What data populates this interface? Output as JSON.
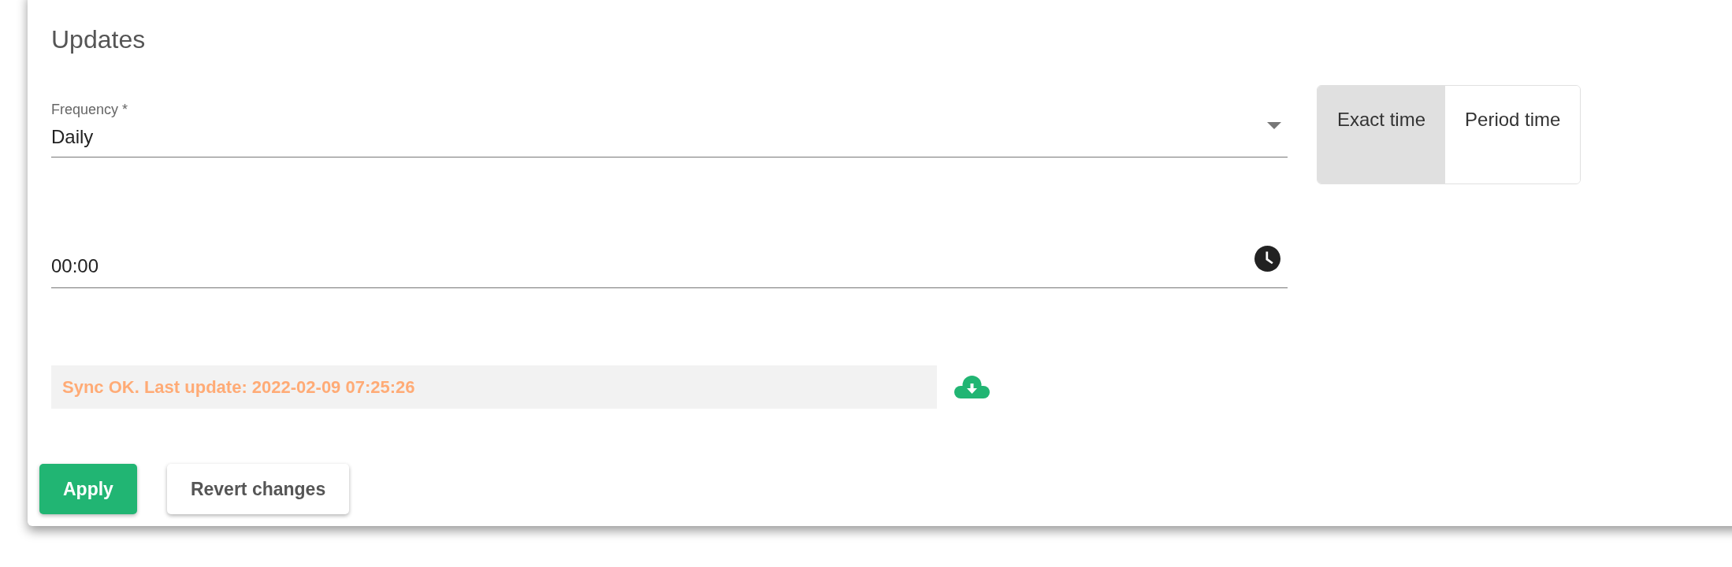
{
  "section": {
    "title": "Updates"
  },
  "frequency": {
    "label": "Frequency *",
    "value": "Daily"
  },
  "time_mode": [
    {
      "label": "Exact time",
      "selected": true
    },
    {
      "label": "Period time",
      "selected": false
    }
  ],
  "time": {
    "value": "00:00"
  },
  "sync_status": {
    "text": "Sync OK. Last update: 2022-02-09 07:25:26"
  },
  "buttons": [
    {
      "label": "Apply",
      "kind": "primary"
    },
    {
      "label": "Revert changes",
      "kind": "secondary"
    }
  ]
}
